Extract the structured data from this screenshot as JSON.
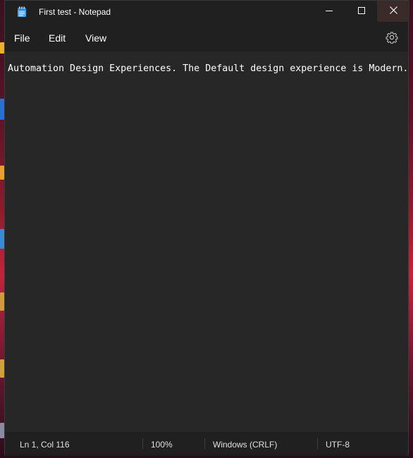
{
  "window": {
    "title": "First test - Notepad",
    "app_icon": "notepad-icon"
  },
  "caption_buttons": {
    "minimize_icon": "minimize-icon",
    "maximize_icon": "maximize-icon",
    "close_icon": "close-icon"
  },
  "menu": {
    "file_label": "File",
    "edit_label": "Edit",
    "view_label": "View",
    "settings_icon": "gear-icon"
  },
  "editor": {
    "content": "Automation Design Experiences. The Default design experience is Modern."
  },
  "status": {
    "position": "Ln 1, Col 116",
    "zoom": "100%",
    "line_ending": "Windows (CRLF)",
    "encoding": "UTF-8"
  },
  "colors": {
    "window_bg": "#272727",
    "chrome_bg": "#202020",
    "text": "#ffffff"
  }
}
